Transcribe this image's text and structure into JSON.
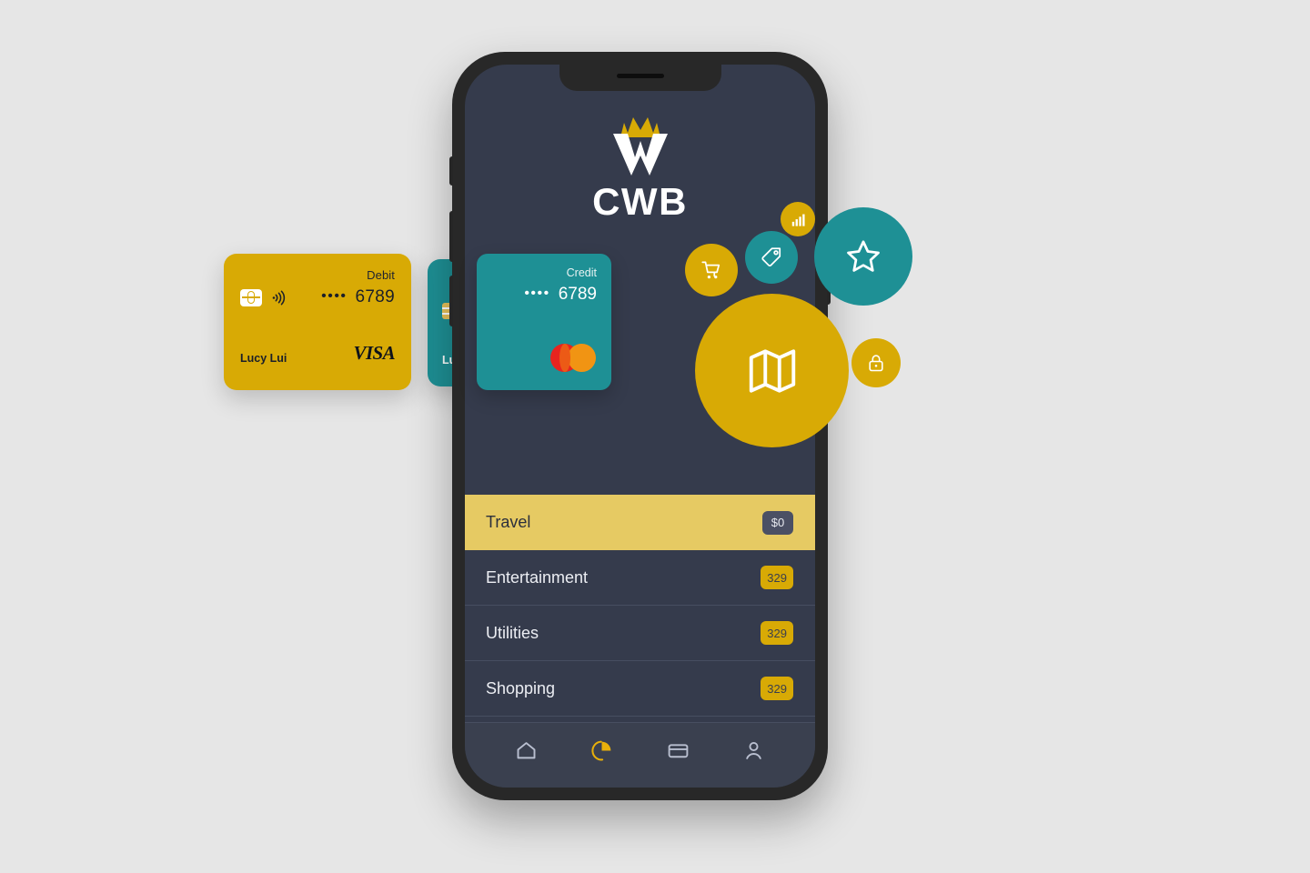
{
  "app": {
    "brand_name": "CWB",
    "logo_icon": "crown-w-logo",
    "accent_gold": "#d8aa05",
    "accent_teal": "#1e9095",
    "screen_bg": "#353b4c",
    "highlight_yellow": "#e6ca63"
  },
  "cards": {
    "debit": {
      "type_label": "Debit",
      "dots": "••••",
      "last4": "6789",
      "holder": "Lucy Lui",
      "network": "VISA",
      "chip_icon": "chip-icon",
      "contactless_icon": "contactless-icon",
      "color": "#d8aa05"
    },
    "credit": {
      "type_label": "Credit",
      "dots": "••••",
      "last4": "6789",
      "network_icon": "mastercard-icon",
      "color": "#1e9095"
    },
    "behind": {
      "holder": "Lu",
      "chip_icon": "chip-icon",
      "color": "#1e9095"
    }
  },
  "bubbles": [
    {
      "icon": "shopping-cart-icon",
      "color": "#d8aa05"
    },
    {
      "icon": "price-tag-icon",
      "color": "#1e9095"
    },
    {
      "icon": "bar-chart-icon",
      "color": "#d8aa05"
    },
    {
      "icon": "map-icon",
      "color": "#d8aa05"
    },
    {
      "icon": "star-icon",
      "color": "#1e9095"
    },
    {
      "icon": "lock-icon",
      "color": "#d8aa05"
    }
  ],
  "categories": [
    {
      "name": "Travel",
      "badge": "$0",
      "active": true
    },
    {
      "name": "Entertainment",
      "badge": "329",
      "active": false
    },
    {
      "name": "Utilities",
      "badge": "329",
      "active": false
    },
    {
      "name": "Shopping",
      "badge": "329",
      "active": false
    }
  ],
  "bottom_nav": [
    {
      "icon": "home-icon",
      "active": false
    },
    {
      "icon": "pie-chart-icon",
      "active": true
    },
    {
      "icon": "credit-card-icon",
      "active": false
    },
    {
      "icon": "profile-icon",
      "active": false
    }
  ]
}
